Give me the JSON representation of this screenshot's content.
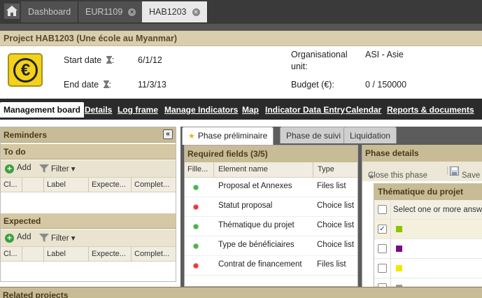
{
  "tabs": [
    {
      "label": "Dashboard"
    },
    {
      "label": "EUR1109"
    },
    {
      "label": "HAB1203"
    }
  ],
  "project": {
    "title": "Project HAB1203 (Une école au Myanmar)",
    "start_label": "Start date",
    "start_value": "6/1/12",
    "end_label": "End date",
    "end_value": "11/3/13",
    "unit_label_1": "Organisational",
    "unit_label_2": "unit:",
    "unit_value": "ASI - Asie",
    "budget_label": "Budget (€):",
    "budget_value": "0 / 150000",
    "icon": "euro-coin-icon"
  },
  "colon": ":",
  "nav": [
    {
      "label": "Management board"
    },
    {
      "label": "Details"
    },
    {
      "label": "Log frame"
    },
    {
      "label": "Manage Indicators"
    },
    {
      "label": "Map"
    },
    {
      "label": "Indicator Data Entry"
    },
    {
      "label": "Calendar"
    },
    {
      "label": "Reports & documents"
    }
  ],
  "reminders": {
    "title": "Reminders",
    "collapse_glyph": "«",
    "todo": {
      "title": "To do",
      "add": "Add",
      "filter": "Filter",
      "columns": [
        "Cl...",
        "",
        "Label",
        "Expecte...",
        "Complet..."
      ]
    },
    "expected": {
      "title": "Expected",
      "add": "Add",
      "filter": "Filter",
      "columns": [
        "Cl...",
        "",
        "Label",
        "Expecte...",
        "Complet..."
      ]
    }
  },
  "phase_tabs": [
    {
      "label": "Phase préliminaire"
    },
    {
      "label": "Phase de suivi"
    },
    {
      "label": "Liquidation"
    }
  ],
  "required": {
    "title": "Required fields (3/5)",
    "columns": [
      "Fille...",
      "Element name",
      "Type"
    ],
    "rows": [
      {
        "status": "green",
        "name": "Proposal et Annexes",
        "type": "Files list"
      },
      {
        "status": "red",
        "name": "Statut proposal",
        "type": "Choice list"
      },
      {
        "status": "green",
        "name": "Thématique du projet",
        "type": "Choice list"
      },
      {
        "status": "green",
        "name": "Type de bénéficiaires",
        "type": "Choice list"
      },
      {
        "status": "red",
        "name": "Contrat de financement",
        "type": "Files list"
      }
    ]
  },
  "phase_details": {
    "title": "Phase details",
    "close_label": "Close this phase",
    "save_label": "Save r"
  },
  "thematique": {
    "title": "Thématique du projet",
    "select_label": "Select one or more answe",
    "options": [
      {
        "checked": true,
        "color": "#8bc400"
      },
      {
        "checked": false,
        "color": "#7a0a8a"
      },
      {
        "checked": false,
        "color": "#f0e800"
      },
      {
        "checked": false,
        "color": "#999999"
      }
    ]
  },
  "related": {
    "title": "Related projects"
  },
  "colors": {
    "topbar": "#3a3a3a",
    "section_header": "#c8bc96",
    "navbar": "#2b2b2b"
  }
}
